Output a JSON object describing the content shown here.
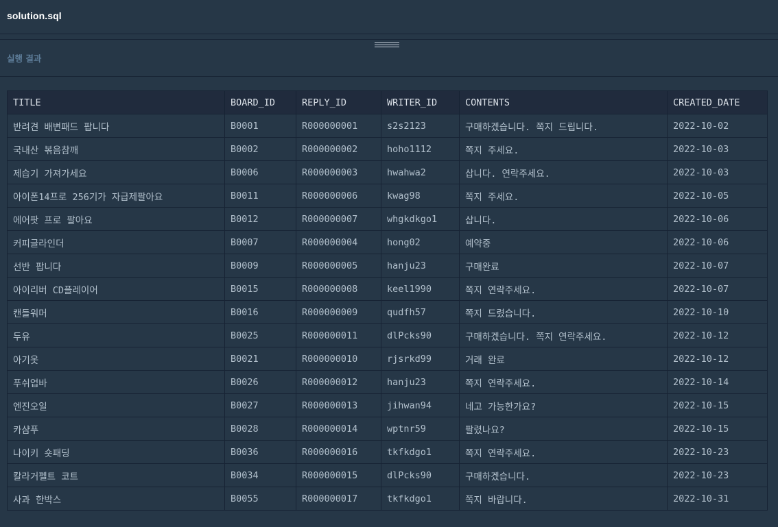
{
  "editor": {
    "file_name": "solution.sql"
  },
  "result": {
    "title": "실행 결과",
    "columns": [
      "TITLE",
      "BOARD_ID",
      "REPLY_ID",
      "WRITER_ID",
      "CONTENTS",
      "CREATED_DATE"
    ],
    "rows": [
      [
        "반려견 배변패드 팝니다",
        "B0001",
        "R000000001",
        "s2s2123",
        "구매하겠습니다. 쪽지 드립니다.",
        "2022-10-02"
      ],
      [
        "국내산 볶음참깨",
        "B0002",
        "R000000002",
        "hoho1112",
        "쪽지 주세요.",
        "2022-10-03"
      ],
      [
        "제습기 가져가세요",
        "B0006",
        "R000000003",
        "hwahwa2",
        "삽니다. 연락주세요.",
        "2022-10-03"
      ],
      [
        "아이폰14프로 256기가 자급제팔아요",
        "B0011",
        "R000000006",
        "kwag98",
        "쪽지 주세요.",
        "2022-10-05"
      ],
      [
        "에어팟 프로 팔아요",
        "B0012",
        "R000000007",
        "whgkdkgo1",
        "삽니다.",
        "2022-10-06"
      ],
      [
        "커피글라인더",
        "B0007",
        "R000000004",
        "hong02",
        "예약중",
        "2022-10-06"
      ],
      [
        "선반 팝니다",
        "B0009",
        "R000000005",
        "hanju23",
        "구매완료",
        "2022-10-07"
      ],
      [
        "아이리버 CD플레이어",
        "B0015",
        "R000000008",
        "keel1990",
        "쪽지 연락주세요.",
        "2022-10-07"
      ],
      [
        "캔들워머",
        "B0016",
        "R000000009",
        "qudfh57",
        "쪽지 드렸습니다.",
        "2022-10-10"
      ],
      [
        "두유",
        "B0025",
        "R000000011",
        "dlPcks90",
        "구매하겠습니다. 쪽지 연락주세요.",
        "2022-10-12"
      ],
      [
        "아기옷",
        "B0021",
        "R000000010",
        "rjsrkd99",
        "거래 완료",
        "2022-10-12"
      ],
      [
        "푸쉬업바",
        "B0026",
        "R000000012",
        "hanju23",
        "쪽지 연락주세요.",
        "2022-10-14"
      ],
      [
        "엔진오일",
        "B0027",
        "R000000013",
        "jihwan94",
        "네고 가능한가요?",
        "2022-10-15"
      ],
      [
        "카샴푸",
        "B0028",
        "R000000014",
        "wptnr59",
        "팔렸나요?",
        "2022-10-15"
      ],
      [
        "나이키 숏패딩",
        "B0036",
        "R000000016",
        "tkfkdgo1",
        "쪽지 연락주세요.",
        "2022-10-23"
      ],
      [
        "칼라거펠트 코트",
        "B0034",
        "R000000015",
        "dlPcks90",
        "구매하겠습니다.",
        "2022-10-23"
      ],
      [
        "사과 한박스",
        "B0055",
        "R000000017",
        "tkfkdgo1",
        "쪽지 바랍니다.",
        "2022-10-31"
      ]
    ]
  },
  "colors": {
    "background": "#263747",
    "header_row": "#202b3d",
    "border": "#172334",
    "header_text": "#dbe1e8",
    "cell_text": "#b2c0cc",
    "section_title": "#5d7c98"
  }
}
